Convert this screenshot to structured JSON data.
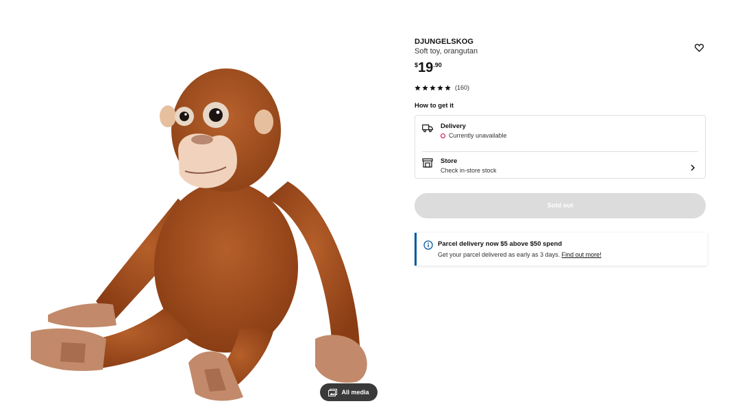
{
  "product": {
    "name": "DJUNGELSKOG",
    "description": "Soft toy, orangutan",
    "price_currency": "$",
    "price_whole": "19",
    "price_decimal": ".90",
    "rating_stars": 5,
    "rating_count": "(160)"
  },
  "media": {
    "all_media_label": "All media",
    "image_subject": "orangutan soft toy"
  },
  "availability": {
    "section_title": "How to get it",
    "delivery_title": "Delivery",
    "delivery_status": "Currently unavailable",
    "store_title": "Store",
    "store_status": "Check in-store stock"
  },
  "actions": {
    "sold_out_label": "Sold out",
    "wishlist_icon": "heart-icon"
  },
  "banner": {
    "title": "Parcel delivery now $5 above $50 spend",
    "text": "Get your parcel delivered as early as 3 days.",
    "link": "Find out more!"
  },
  "colors": {
    "status_unavailable": "#cc0033",
    "banner_accent": "#0058a3",
    "sold_out_bg": "#dcdcdc",
    "fur": "#a8521f"
  }
}
